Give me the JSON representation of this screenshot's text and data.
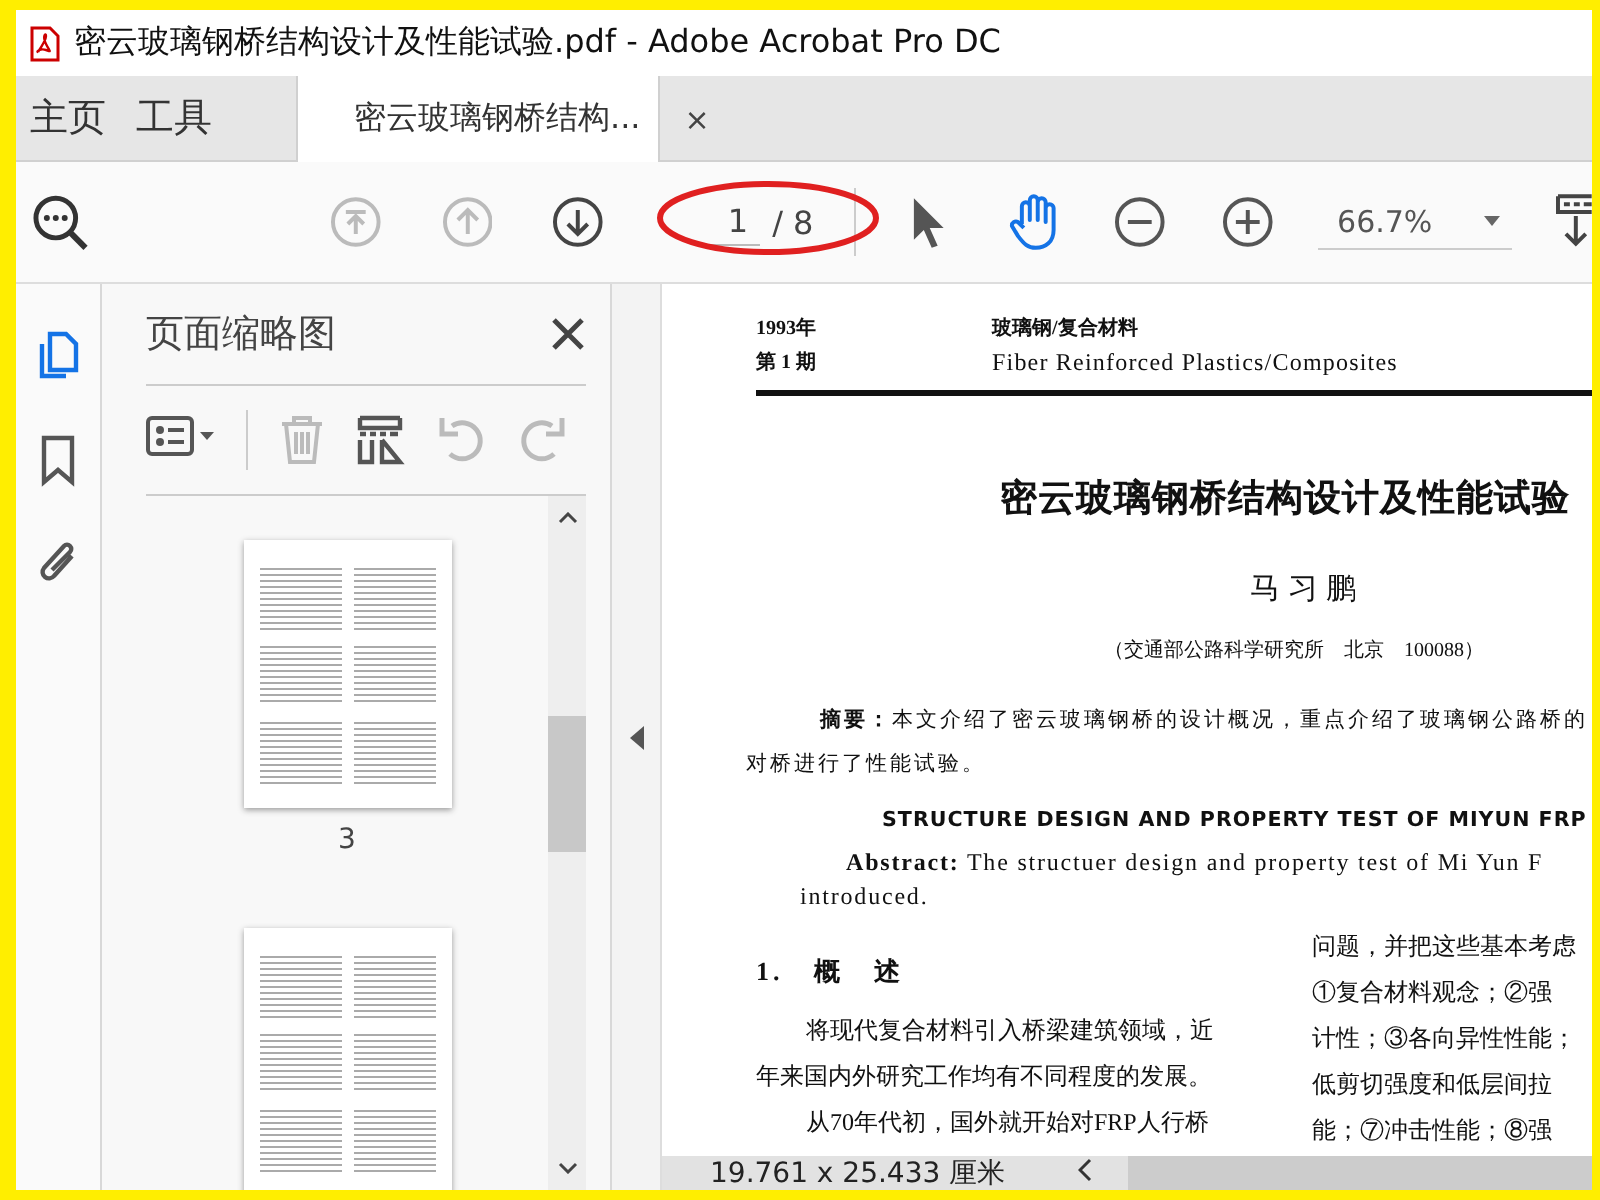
{
  "window": {
    "title": "密云玻璃钢桥结构设计及性能试验.pdf - Adobe Acrobat Pro DC"
  },
  "tabs": [
    {
      "label": "主页",
      "selected": false
    },
    {
      "label": "工具",
      "selected": false
    },
    {
      "label": "密云玻璃钢桥结构...",
      "selected": true,
      "close_label": "×"
    }
  ],
  "toolbar": {
    "nav_buttons": [
      {
        "kind": "first",
        "disabled": true
      },
      {
        "kind": "previous",
        "disabled": true
      },
      {
        "kind": "next",
        "disabled": false
      }
    ],
    "page_number": "1",
    "page_total": "/ 8",
    "tools": [
      {
        "kind": "pointer",
        "selected": false
      },
      {
        "kind": "hand",
        "selected": true
      }
    ],
    "zoom": "66.7%"
  },
  "side_rail": [
    {
      "kind": "pages",
      "selected": true
    },
    {
      "kind": "bookmarks",
      "selected": false
    },
    {
      "kind": "attachments",
      "selected": false
    }
  ],
  "panel": {
    "title": "页面缩略图",
    "tools": [
      {
        "kind": "options",
        "disabled": false
      },
      {
        "kind": "delete",
        "disabled": true
      },
      {
        "kind": "extract",
        "disabled": false
      },
      {
        "kind": "rotate_left",
        "disabled": true
      },
      {
        "kind": "rotate_right",
        "disabled": true
      }
    ],
    "thumbnails": [
      {
        "label": "3"
      }
    ]
  },
  "document": {
    "issue_year": "1993年",
    "issue_number": "第 1 期",
    "journal_cn": "玻璃钢/复合材料",
    "journal_en": "Fiber Reinforced Plastics/Composites",
    "title": "密云玻璃钢桥结构设计及性能试验",
    "author": "马习鹏",
    "affiliation": "（交通部公路科学研究所　北京　100088）",
    "abstract_cn": [
      "**摘要：**本文介绍了密云玻璃钢桥的设计概况，重点介绍了玻璃钢公路桥的",
      "对桥进行了性能试验。"
    ],
    "title_en": "STRUCTURE DESIGN AND PROPERTY TEST OF MIYUN FRP",
    "abstract_en": [
      "**Abstract:** The structuer design and property test of Mi Yun F",
      "introduced."
    ],
    "section_heading": "1.　概　述",
    "left_column": [
      "将现代复合材料引入桥梁建筑领域，近",
      "年来国内外研究工作均有不同程度的发展。",
      "从70年代初，国外就开始对FRP人行桥"
    ],
    "right_column": [
      "问题，并把这些基本考虑",
      "①复合材料观念；②强",
      "计性；③各向异性性能；",
      "低剪切强度和低层间拉",
      "能；⑦冲击性能；⑧强"
    ]
  },
  "status_bar": {
    "page_size": "19.761 x 25.433 厘米"
  }
}
